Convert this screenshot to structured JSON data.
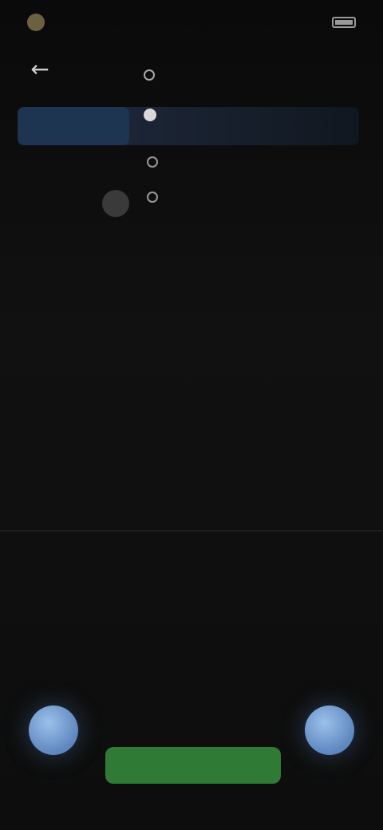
{
  "status_bar": {
    "time": "",
    "battery": ""
  },
  "header": {
    "back_icon": "arrow-left-icon"
  },
  "nav": {
    "items": [
      {
        "label": ""
      },
      {
        "label": ""
      }
    ]
  },
  "options": [
    {
      "label": "",
      "sub": ""
    },
    {
      "label": ""
    }
  ],
  "section_label": "",
  "words": [
    "",
    "",
    "",
    "",
    "",
    "",
    "",
    ""
  ],
  "buttons": {
    "left_fab_icon": "circle-icon",
    "right_fab_icon": "circle-icon",
    "primary_label": ""
  },
  "colors": {
    "accent_blue": "#5d87bf",
    "primary_green": "#2f7a35",
    "highlight": "#1d3550"
  }
}
